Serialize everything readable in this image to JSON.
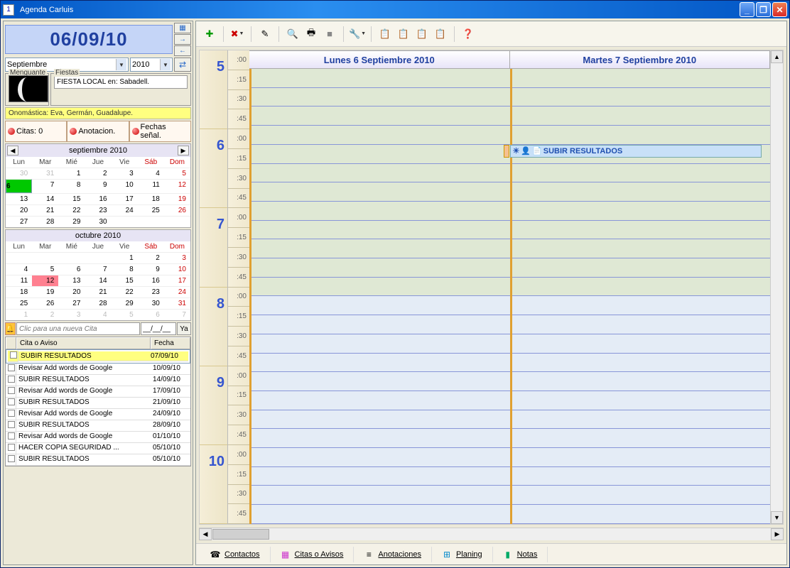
{
  "window": {
    "title": "Agenda Carluis"
  },
  "date_display": "06/09/10",
  "month_select": "Septiembre",
  "year_select": "2010",
  "moon_label": "Menguante",
  "fiestas_label": "Fiestas",
  "fiestas_text": "FIESTA LOCAL en: Sabadell.",
  "onomastica": "Onomástica: Eva, Germán, Guadalupe.",
  "pills": {
    "citas": "Citas: 0",
    "anot": "Anotacion.",
    "fechas": "Fechas señal."
  },
  "cal1": {
    "title": "septiembre 2010",
    "dow": [
      "Lun",
      "Mar",
      "Mié",
      "Jue",
      "Vie",
      "Sáb",
      "Dom"
    ],
    "rows": [
      [
        {
          "n": "30",
          "m": true
        },
        {
          "n": "31",
          "m": true
        },
        {
          "n": "1"
        },
        {
          "n": "2"
        },
        {
          "n": "3"
        },
        {
          "n": "4"
        },
        {
          "n": "5",
          "we": true
        }
      ],
      [
        {
          "n": "6",
          "sel": true
        },
        {
          "n": "7"
        },
        {
          "n": "8"
        },
        {
          "n": "9"
        },
        {
          "n": "10"
        },
        {
          "n": "11"
        },
        {
          "n": "12",
          "we": true
        }
      ],
      [
        {
          "n": "13"
        },
        {
          "n": "14"
        },
        {
          "n": "15"
        },
        {
          "n": "16"
        },
        {
          "n": "17"
        },
        {
          "n": "18"
        },
        {
          "n": "19",
          "we": true
        }
      ],
      [
        {
          "n": "20"
        },
        {
          "n": "21"
        },
        {
          "n": "22"
        },
        {
          "n": "23"
        },
        {
          "n": "24"
        },
        {
          "n": "25"
        },
        {
          "n": "26",
          "we": true
        }
      ],
      [
        {
          "n": "27"
        },
        {
          "n": "28"
        },
        {
          "n": "29"
        },
        {
          "n": "30"
        },
        {
          "n": ""
        },
        {
          "n": ""
        },
        {
          "n": ""
        }
      ]
    ]
  },
  "cal2": {
    "title": "octubre 2010",
    "dow": [
      "Lun",
      "Mar",
      "Mié",
      "Jue",
      "Vie",
      "Sáb",
      "Dom"
    ],
    "rows": [
      [
        {
          "n": ""
        },
        {
          "n": ""
        },
        {
          "n": ""
        },
        {
          "n": ""
        },
        {
          "n": "1"
        },
        {
          "n": "2"
        },
        {
          "n": "3",
          "we": true
        }
      ],
      [
        {
          "n": "4"
        },
        {
          "n": "5"
        },
        {
          "n": "6"
        },
        {
          "n": "7"
        },
        {
          "n": "8"
        },
        {
          "n": "9"
        },
        {
          "n": "10",
          "we": true
        }
      ],
      [
        {
          "n": "11"
        },
        {
          "n": "12",
          "hl": true
        },
        {
          "n": "13"
        },
        {
          "n": "14"
        },
        {
          "n": "15"
        },
        {
          "n": "16"
        },
        {
          "n": "17",
          "we": true
        }
      ],
      [
        {
          "n": "18"
        },
        {
          "n": "19"
        },
        {
          "n": "20"
        },
        {
          "n": "21"
        },
        {
          "n": "22"
        },
        {
          "n": "23"
        },
        {
          "n": "24",
          "we": true
        }
      ],
      [
        {
          "n": "25"
        },
        {
          "n": "26"
        },
        {
          "n": "27"
        },
        {
          "n": "28"
        },
        {
          "n": "29"
        },
        {
          "n": "30"
        },
        {
          "n": "31",
          "we": true
        }
      ],
      [
        {
          "n": "1",
          "m": true
        },
        {
          "n": "2",
          "m": true
        },
        {
          "n": "3",
          "m": true
        },
        {
          "n": "4",
          "m": true
        },
        {
          "n": "5",
          "m": true
        },
        {
          "n": "6",
          "m": true
        },
        {
          "n": "7",
          "m": true
        }
      ]
    ]
  },
  "new_cita_placeholder": "Clic para una nueva Cita",
  "new_cita_go": "Ya",
  "tasks": {
    "col1": "Cita o Aviso",
    "col2": "Fecha",
    "rows": [
      {
        "t": "SUBIR RESULTADOS",
        "d": "07/09/10",
        "sel": true
      },
      {
        "t": "Revisar Add words de Google",
        "d": "10/09/10"
      },
      {
        "t": "SUBIR RESULTADOS",
        "d": "14/09/10"
      },
      {
        "t": "Revisar Add words de Google",
        "d": "17/09/10"
      },
      {
        "t": "SUBIR RESULTADOS",
        "d": "21/09/10"
      },
      {
        "t": "Revisar Add words de Google",
        "d": "24/09/10"
      },
      {
        "t": "SUBIR RESULTADOS",
        "d": "28/09/10"
      },
      {
        "t": "Revisar Add words de Google",
        "d": "01/10/10"
      },
      {
        "t": "HACER COPIA SEGURIDAD ...",
        "d": "05/10/10"
      },
      {
        "t": "SUBIR RESULTADOS",
        "d": "05/10/10"
      }
    ]
  },
  "day_headers": [
    "Lunes 6 Septiembre 2010",
    "Martes 7 Septiembre 2010"
  ],
  "hours": [
    "5",
    "6",
    "7",
    "8",
    "9",
    "10"
  ],
  "minutes": [
    ":00",
    ":15",
    ":30",
    ":45"
  ],
  "event": {
    "text": "SUBIR RESULTADOS"
  },
  "bottom_tabs": {
    "contactos": "Contactos",
    "citas": "Citas o Avisos",
    "anot": "Anotaciones",
    "plan": "Planing",
    "notas": "Notas"
  }
}
